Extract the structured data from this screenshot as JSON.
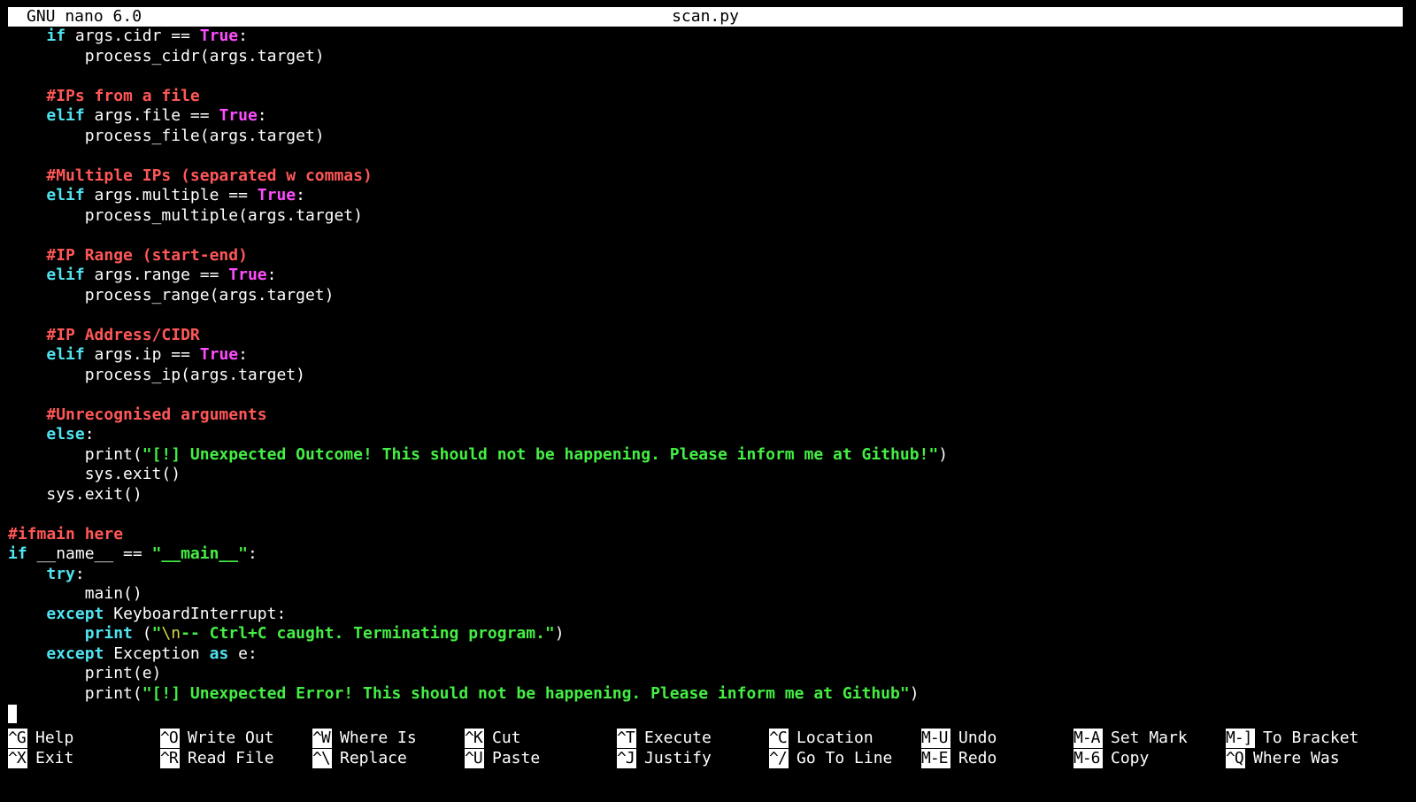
{
  "titlebar": {
    "app_version": "GNU nano 6.0",
    "filename": "scan.py"
  },
  "code": {
    "l1_kw": "if",
    "l1_a": " args.cidr == ",
    "l1_b": "True",
    "l1_c": ":",
    "l2": "process_cidr(args.target)",
    "l4": "#IPs from a file",
    "l5_kw": "elif",
    "l5_a": " args.file == ",
    "l5_b": "True",
    "l5_c": ":",
    "l6": "process_file(args.target)",
    "l8": "#Multiple IPs (separated w commas)",
    "l9_kw": "elif",
    "l9_a": " args.multiple == ",
    "l9_b": "True",
    "l9_c": ":",
    "l10": "process_multiple(args.target)",
    "l12": "#IP Range (start-end)",
    "l13_kw": "elif",
    "l13_a": " args.range == ",
    "l13_b": "True",
    "l13_c": ":",
    "l14": "process_range(args.target)",
    "l16": "#IP Address/CIDR",
    "l17_kw": "elif",
    "l17_a": " args.ip == ",
    "l17_b": "True",
    "l17_c": ":",
    "l18": "process_ip(args.target)",
    "l20": "#Unrecognised arguments",
    "l21_kw": "else",
    "l21_c": ":",
    "l22_a": "print(",
    "l22_s": "\"[!] Unexpected Outcome! This should not be happening. Please inform me at Github!\"",
    "l22_c": ")",
    "l23": "sys.exit()",
    "l24": "sys.exit()",
    "l26": "#ifmain here",
    "l27_kw": "if",
    "l27_a": " __name__ == ",
    "l27_s": "\"__main__\"",
    "l27_c": ":",
    "l28_kw": "try",
    "l28_c": ":",
    "l29": "main()",
    "l30_kw": "except",
    "l30_a": " KeyboardInterrupt:",
    "l31_kw": "print",
    "l31_a": " (",
    "l31_s1": "\"",
    "l31_esc": "\\n",
    "l31_s2": "-- Ctrl+C caught. Terminating program.\"",
    "l31_c": ")",
    "l32_kw": "except",
    "l32_a": " Exception ",
    "l32_kw2": "as",
    "l32_b": " e:",
    "l33": "print(e)",
    "l34_a": "print(",
    "l34_s": "\"[!] Unexpected Error! This should not be happening. Please inform me at Github\"",
    "l34_c": ")"
  },
  "shortcuts": [
    {
      "key": "^G",
      "label": "Help"
    },
    {
      "key": "^X",
      "label": "Exit"
    },
    {
      "key": "^O",
      "label": "Write Out"
    },
    {
      "key": "^R",
      "label": "Read File"
    },
    {
      "key": "^W",
      "label": "Where Is"
    },
    {
      "key": "^\\",
      "label": "Replace"
    },
    {
      "key": "^K",
      "label": "Cut"
    },
    {
      "key": "^U",
      "label": "Paste"
    },
    {
      "key": "^T",
      "label": "Execute"
    },
    {
      "key": "^J",
      "label": "Justify"
    },
    {
      "key": "^C",
      "label": "Location"
    },
    {
      "key": "^/",
      "label": "Go To Line"
    },
    {
      "key": "M-U",
      "label": "Undo"
    },
    {
      "key": "M-E",
      "label": "Redo"
    },
    {
      "key": "M-A",
      "label": "Set Mark"
    },
    {
      "key": "M-6",
      "label": "Copy"
    },
    {
      "key": "M-]",
      "label": "To Bracket"
    },
    {
      "key": "^Q",
      "label": "Where Was"
    }
  ]
}
